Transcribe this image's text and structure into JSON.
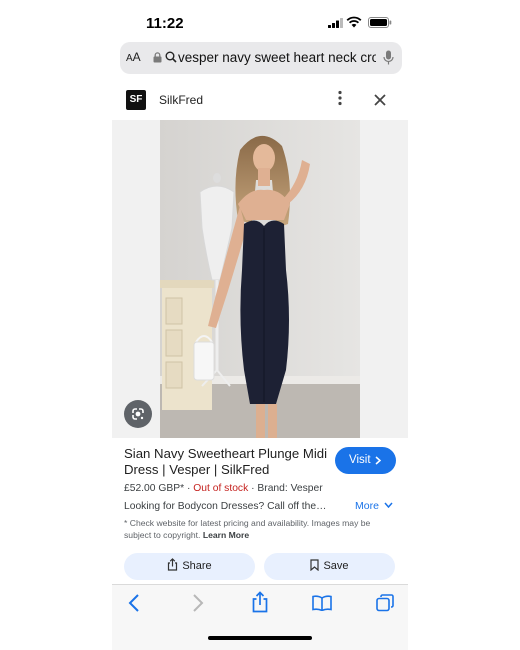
{
  "status_bar": {
    "time": "11:22"
  },
  "url_bar": {
    "aa_label": "AA",
    "query": "vesper navy sweet heart neck cross"
  },
  "result": {
    "site_logo": "SF",
    "site_name": "SilkFred",
    "title": "Sian Navy Sweetheart Plunge Midi Dress | Vesper | SilkFred",
    "visit_label": "Visit",
    "price": "£52.00 GBP*",
    "stock": "Out of stock",
    "brand": "Brand: Vesper",
    "description": "Looking for Bodycon Dresses? Call off the…",
    "more_label": "More",
    "disclaimer": "* Check website for latest pricing and availability. Images may be subject to copyright.",
    "learn_more": "Learn More",
    "share_label": "Share",
    "save_label": "Save"
  },
  "icons": {
    "lens": "google-lens-icon",
    "kebab": "more-vert-icon",
    "close": "close-icon",
    "back": "back-icon",
    "forward": "forward-icon",
    "share": "share-icon",
    "bookmarks": "bookmarks-icon",
    "tabs": "tabs-icon"
  },
  "colors": {
    "accent": "#1a73e8",
    "out_of_stock": "#c5221f",
    "pill_bg": "#e8f0fe"
  }
}
